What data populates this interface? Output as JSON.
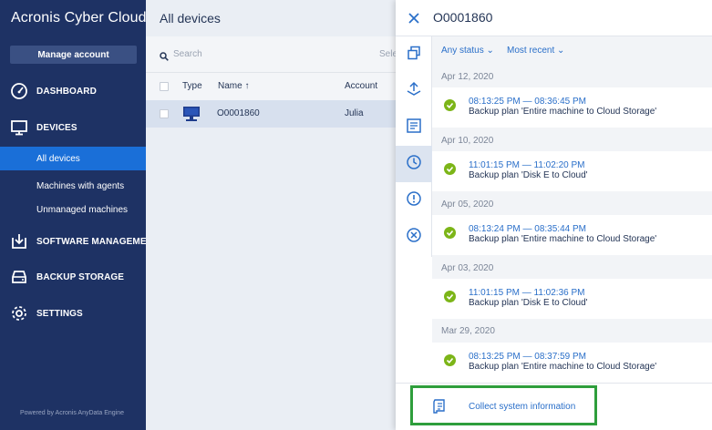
{
  "sidebar": {
    "logo": "Acronis Cyber Cloud",
    "manage_account": "Manage account",
    "sections": [
      {
        "label": "DASHBOARD",
        "icon": "dashboard-gauge-icon"
      },
      {
        "label": "DEVICES",
        "icon": "monitor-icon"
      },
      {
        "label": "SOFTWARE MANAGEMENT",
        "icon": "software-download-icon"
      },
      {
        "label": "BACKUP STORAGE",
        "icon": "storage-drive-icon"
      },
      {
        "label": "SETTINGS",
        "icon": "gear-icon"
      }
    ],
    "device_items": [
      "All devices",
      "Machines with agents",
      "Unmanaged machines"
    ],
    "active_item": "All devices",
    "powered_by": "Powered by Acronis AnyData Engine",
    "colors": {
      "background": "#1e3264",
      "active": "#1a6fd8"
    }
  },
  "main": {
    "title": "All devices",
    "search_placeholder": "Search",
    "select_text": "Sele",
    "columns": [
      "Type",
      "Name ↑",
      "Account"
    ],
    "rows": [
      {
        "type_icon": "desktop-icon",
        "name": "O0001860",
        "account": "Julia"
      }
    ]
  },
  "panel": {
    "title": "O0001860",
    "filters": {
      "status": "Any status",
      "sort": "Most recent"
    },
    "tabs": [
      "overview-icon",
      "protect-icon",
      "report-icon",
      "activities-clock-icon",
      "alerts-icon",
      "cancel-icon"
    ],
    "active_tab": 3,
    "activities": [
      {
        "date": "Apr 12, 2020",
        "time": "08:13:25 PM — 08:36:45 PM",
        "desc": "Backup plan 'Entire machine to Cloud Storage'"
      },
      {
        "date": "Apr 10, 2020",
        "time": "11:01:15 PM — 11:02:20 PM",
        "desc": "Backup plan 'Disk E to Cloud'"
      },
      {
        "date": "Apr 05, 2020",
        "time": "08:13:24 PM — 08:35:44 PM",
        "desc": "Backup plan 'Entire machine to Cloud Storage'"
      },
      {
        "date": "Apr 03, 2020",
        "time": "11:01:15 PM — 11:02:36 PM",
        "desc": "Backup plan 'Disk E to Cloud'"
      },
      {
        "date": "Mar 29, 2020",
        "time": "08:13:25 PM — 08:37:59 PM",
        "desc": "Backup plan 'Entire machine to Cloud Storage'"
      }
    ],
    "collect_label": "Collect system information",
    "colors": {
      "link": "#2a6fc9",
      "success": "#7cb518",
      "highlight": "#2e9e3c"
    }
  }
}
